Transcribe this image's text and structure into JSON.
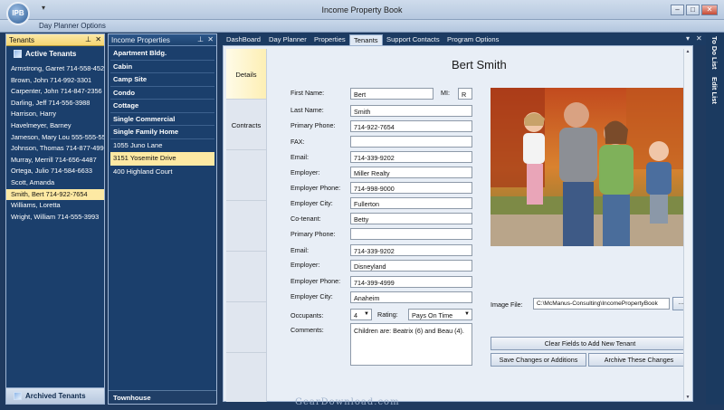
{
  "window": {
    "title": "Income Property Book",
    "logo_text": "IPB",
    "min": "–",
    "max": "□",
    "close": "✕"
  },
  "ribbon": {
    "tab": "Day Planner Options",
    "qat_arrow": "▾"
  },
  "tenants_panel": {
    "title": "Tenants",
    "pin": "📌",
    "close": "✕",
    "group": "Active Tenants",
    "items": [
      "Armstrong, Garret  714-558-4521",
      "Brown, John  714-992-3301",
      "Carpenter, John  714-847-2356",
      "Darling, Jeff  714-556-3988",
      "Harrison, Harry",
      "Havelmeyer, Barney",
      "Jameson, Mary Lou  555-555-5555",
      "Johnson, Thomas  714-877-4990",
      "Murray, Merrill  714-656-4487",
      "Ortega, Julio  714-584-6633",
      "Scott, Amanda",
      "Smith, Bert  714-922-7654",
      "Williams, Loretta",
      "Wright, William  714-555-3993"
    ],
    "selected_index": 11,
    "archived": "Archived Tenants"
  },
  "properties_panel": {
    "title": "Income Properties",
    "pin": "📌",
    "close": "✕",
    "categories": [
      "Apartment Bldg.",
      "Cabin",
      "Camp Site",
      "Condo",
      "Cottage",
      "Single Commercial",
      "Single Family Home"
    ],
    "items": [
      "1055 Juno Lane",
      "3151 Yosemite Drive",
      "400 Highland Court"
    ],
    "selected_item": "3151 Yosemite Drive",
    "footer": "Townhouse"
  },
  "doc_tabs": {
    "tabs": [
      "DashBoard",
      "Day Planner",
      "Properties",
      "Tenants",
      "Support Contacts",
      "Program Options"
    ],
    "active": "Tenants",
    "dropdown": "▾",
    "close": "✕"
  },
  "side_tabs": {
    "details": "Details",
    "contracts": "Contracts"
  },
  "tenant": {
    "name": "Bert Smith",
    "labels": {
      "first_name": "First Name:",
      "mi": "MI:",
      "last_name": "Last Name:",
      "primary_phone": "Primary Phone:",
      "fax": "FAX:",
      "email": "Email:",
      "employer": "Employer:",
      "employer_phone": "Employer Phone:",
      "employer_city": "Employer City:",
      "cotenant": "Co-tenant:",
      "co_primary_phone": "Primary Phone:",
      "co_email": "Email:",
      "co_employer": "Employer:",
      "co_employer_phone": "Employer Phone:",
      "co_employer_city": "Employer City:",
      "occupants": "Occupants:",
      "rating": "Rating:",
      "comments": "Comments:",
      "image_file": "Image File:"
    },
    "values": {
      "first_name": "Bert",
      "mi": "R",
      "last_name": "Smith",
      "primary_phone": "714-922-7654",
      "fax": "",
      "email": "714-339-9202",
      "employer": "Miller Realty",
      "employer_phone": "714-998-9000",
      "employer_city": "Fullerton",
      "cotenant": "Betty",
      "co_primary_phone": "",
      "co_email": "714-339-9202",
      "co_employer": "Disneyland",
      "co_employer_phone": "714-399-4999",
      "co_employer_city": "Anaheim",
      "occupants": "4",
      "rating": "Pays On Time",
      "comments": "Children are: Beatrix (6) and Beau (4).",
      "image_file": "C:\\McManus-Consulting\\IncomePropertyBook"
    }
  },
  "buttons": {
    "browse": "...",
    "clear": "Clear Fields to Add New Tenant",
    "save": "Save Changes or Additions",
    "archive": "Archive These Changes"
  },
  "right_bar": {
    "todo": "To Do List",
    "edit": "Edit List"
  },
  "watermark": "GearDownload.com",
  "colors": {
    "frame": "#1f3a5f",
    "panel": "#1b3f6c",
    "selection": "#fde9a3",
    "content_bg": "#e8eef6"
  }
}
